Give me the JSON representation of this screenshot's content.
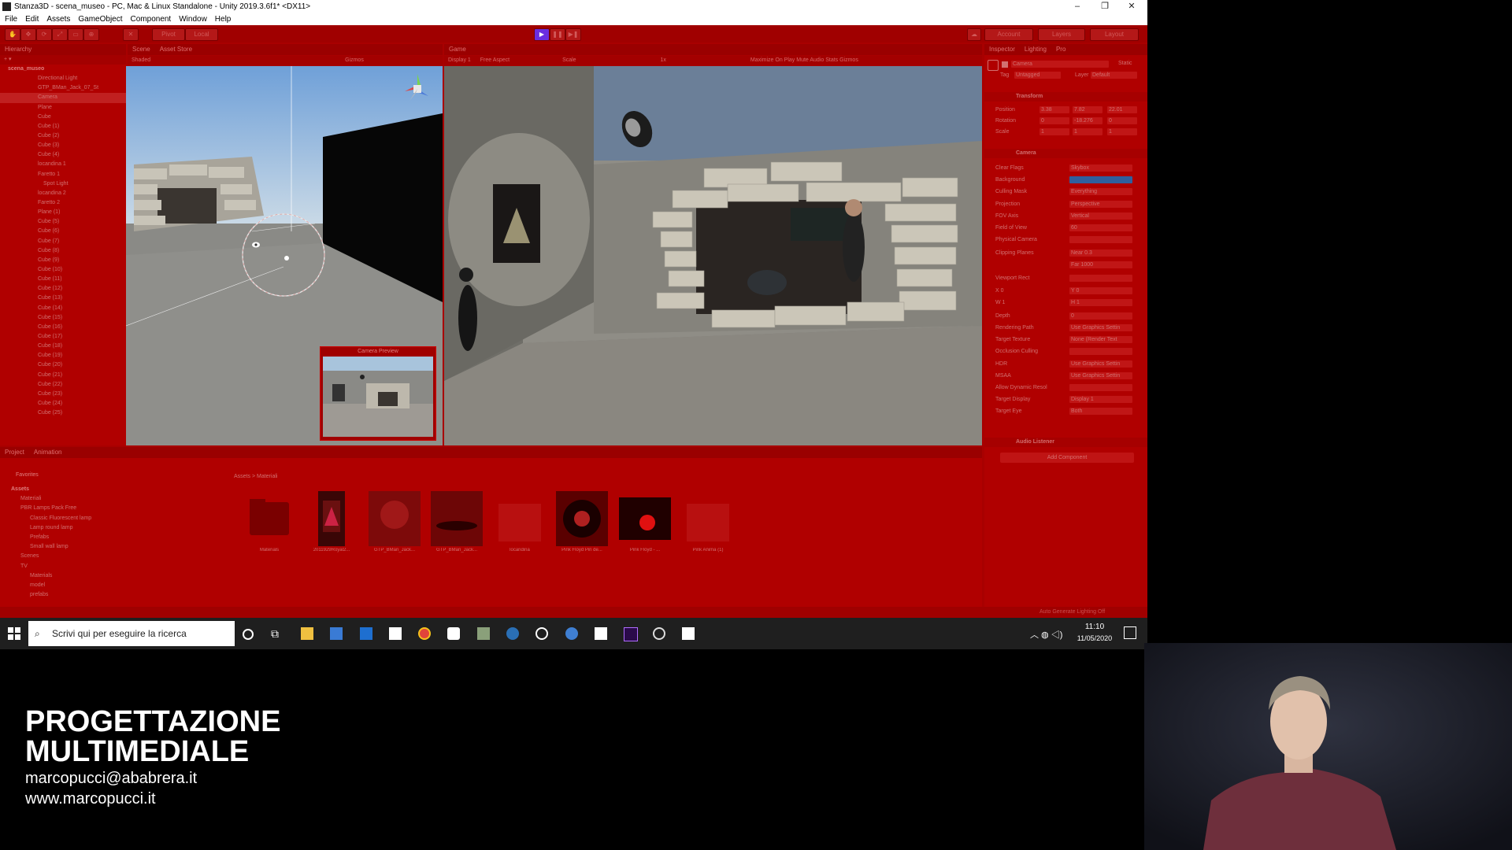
{
  "window": {
    "title": "Stanza3D - scena_museo - PC, Mac & Linux Standalone - Unity 2019.3.6f1* <DX11>",
    "buttons": [
      "–",
      "❐",
      "✕"
    ]
  },
  "menu": [
    "File",
    "Edit",
    "Assets",
    "GameObject",
    "Component",
    "Window",
    "Help"
  ],
  "toolbar": {
    "pivot": "Pivot",
    "local": "Local",
    "account": "Account",
    "layers": "Layers",
    "layout": "Layout"
  },
  "hierarchy": {
    "tab": "Hierarchy",
    "root": "scena_museo",
    "items": [
      "Directional Light",
      "GTP_BMan_Jack_07_St",
      "Camera",
      "Plane",
      "Cube",
      "Cube (1)",
      "Cube (2)",
      "Cube (3)",
      "Cube (4)",
      "locandina 1",
      "Faretto 1",
      "Spot Light",
      "locandina 2",
      "Faretto 2",
      "Plane (1)",
      "Cube (5)",
      "Cube (6)",
      "Cube (7)",
      "Cube (8)",
      "Cube (9)",
      "Cube (10)",
      "Cube (11)",
      "Cube (12)",
      "Cube (13)",
      "Cube (14)",
      "Cube (15)",
      "Cube (16)",
      "Cube (17)",
      "Cube (18)",
      "Cube (19)",
      "Cube (20)",
      "Cube (21)",
      "Cube (22)",
      "Cube (23)",
      "Cube (24)",
      "Cube (25)"
    ]
  },
  "scene": {
    "tabs": [
      "Scene",
      "Asset Store"
    ],
    "shading": "Shaded",
    "gizmos": "Gizmos",
    "camera_preview": "Camera Preview"
  },
  "game": {
    "tab": "Game",
    "display": "Display 1",
    "aspect": "Free Aspect",
    "scale_label": "Scale",
    "scale_value": "1x",
    "options": "Maximize On Play   Mute Audio   Stats   Gizmos"
  },
  "inspector": {
    "tabs": [
      "Inspector",
      "Lighting",
      "Pro"
    ],
    "object_name": "Camera",
    "static": "Static",
    "tag_label": "Tag",
    "tag": "Untagged",
    "layer_label": "Layer",
    "layer": "Default",
    "transform": {
      "header": "Transform",
      "position_label": "Position",
      "position": [
        "3.38",
        "7.82",
        "22.01"
      ],
      "rotation_label": "Rotation",
      "rotation": [
        "0",
        "-18.276",
        "0"
      ],
      "scale_label": "Scale",
      "scale": [
        "1",
        "1",
        "1"
      ]
    },
    "camera": {
      "header": "Camera",
      "rows": [
        {
          "label": "Clear Flags",
          "value": "Skybox"
        },
        {
          "label": "Background",
          "value": ""
        },
        {
          "label": "Culling Mask",
          "value": "Everything"
        },
        {
          "label": "Projection",
          "value": "Perspective"
        },
        {
          "label": "FOV Axis",
          "value": "Vertical"
        },
        {
          "label": "Field of View",
          "value": "60"
        },
        {
          "label": "Physical Camera",
          "value": ""
        },
        {
          "label": "Clipping Planes",
          "value": "Near  0.3"
        },
        {
          "label": "",
          "value": "Far  1000"
        },
        {
          "label": "Viewport Rect",
          "value": ""
        },
        {
          "label": "X  0",
          "value": "Y  0"
        },
        {
          "label": "W  1",
          "value": "H  1"
        },
        {
          "label": "Depth",
          "value": "0"
        },
        {
          "label": "Rendering Path",
          "value": "Use Graphics Settin"
        },
        {
          "label": "Target Texture",
          "value": "None (Render Text"
        },
        {
          "label": "Occlusion Culling",
          "value": ""
        },
        {
          "label": "HDR",
          "value": "Use Graphics Settin"
        },
        {
          "label": "MSAA",
          "value": "Use Graphics Settin"
        },
        {
          "label": "Allow Dynamic Resol",
          "value": ""
        },
        {
          "label": "Target Display",
          "value": "Display 1"
        },
        {
          "label": "Target Eye",
          "value": "Both"
        }
      ],
      "background_color": "#2f5f9e"
    },
    "audio_listener": "Audio Listener",
    "add_component": "Add Component"
  },
  "project": {
    "tabs": [
      "Project",
      "Animation"
    ],
    "favorites": "Favorites",
    "breadcrumb": [
      "Assets",
      "Materiali"
    ],
    "tree": [
      {
        "label": "Assets",
        "indent": 0
      },
      {
        "label": "Materiali",
        "indent": 1
      },
      {
        "label": "PBR Lamps Pack Free",
        "indent": 1
      },
      {
        "label": "Classic Fluorescent lamp",
        "indent": 2
      },
      {
        "label": "Lamp round lamp",
        "indent": 2
      },
      {
        "label": "Prefabs",
        "indent": 2
      },
      {
        "label": "Small wall lamp",
        "indent": 2
      },
      {
        "label": "Scenes",
        "indent": 1
      },
      {
        "label": "TV",
        "indent": 1
      },
      {
        "label": "Materials",
        "indent": 2
      },
      {
        "label": "model",
        "indent": 2
      },
      {
        "label": "prefabs",
        "indent": 2
      }
    ],
    "assets": [
      {
        "label": "Materials",
        "kind": "folder"
      },
      {
        "label": "2011929Royal2...",
        "kind": "poster"
      },
      {
        "label": "GTP_BMan_Jack...",
        "kind": "dark"
      },
      {
        "label": "GTP_BMan_Jack...",
        "kind": "dark2"
      },
      {
        "label": "locandina",
        "kind": "blank"
      },
      {
        "label": "Pink Floyd Pin de...",
        "kind": "disc"
      },
      {
        "label": "Pink Floyd - ...",
        "kind": "glow"
      },
      {
        "label": "Pink Anima (1)",
        "kind": "blank"
      }
    ]
  },
  "status": "Auto Generate Lighting Off",
  "taskbar": {
    "search_placeholder": "Scrivi qui per eseguire la ricerca",
    "time": "11:10",
    "date": "11/05/2020"
  },
  "overlay": {
    "course_line1": "PROGETTAZIONE",
    "course_line2": "MULTIMEDIALE",
    "email": "marcopucci@ababrera.it",
    "website": "www.marcopucci.it"
  }
}
